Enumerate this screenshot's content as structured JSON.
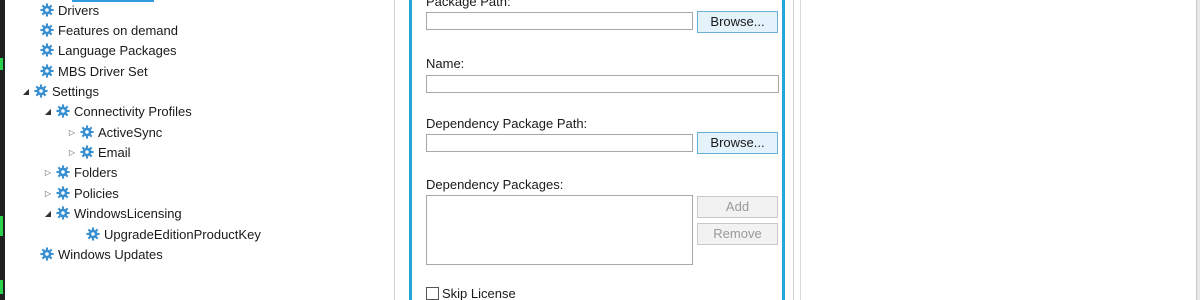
{
  "colors": {
    "gear": "#3a8fd0",
    "accent": "#25a7d8",
    "button_bg": "#e3f2fb"
  },
  "tree": {
    "items": [
      {
        "label": "Drivers",
        "icon": "gear-icon"
      },
      {
        "label": "Features on demand",
        "icon": "gear-icon"
      },
      {
        "label": "Language Packages",
        "icon": "gear-icon"
      },
      {
        "label": "MBS Driver Set",
        "icon": "gear-icon"
      },
      {
        "label": "Settings",
        "icon": "gear-icon",
        "expanded": true
      },
      {
        "label": "Connectivity Profiles",
        "icon": "gear-icon",
        "expanded": true
      },
      {
        "label": "ActiveSync",
        "icon": "gear-icon",
        "expanded": false
      },
      {
        "label": "Email",
        "icon": "gear-icon",
        "expanded": false
      },
      {
        "label": "Folders",
        "icon": "gear-icon",
        "expanded": false
      },
      {
        "label": "Policies",
        "icon": "gear-icon",
        "expanded": false
      },
      {
        "label": "WindowsLicensing",
        "icon": "gear-icon",
        "expanded": true
      },
      {
        "label": "UpgradeEditionProductKey",
        "icon": "gear-icon"
      },
      {
        "label": "Windows Updates",
        "icon": "gear-icon"
      }
    ]
  },
  "form": {
    "package_path_label": "Package Path:",
    "package_path_value": "",
    "browse_label_1": "Browse...",
    "name_label": "Name:",
    "name_value": "",
    "dependency_path_label": "Dependency Package Path:",
    "dependency_path_value": "",
    "browse_label_2": "Browse...",
    "dependency_packages_label": "Dependency Packages:",
    "add_label": "Add",
    "remove_label": "Remove",
    "skip_license_label": "Skip License"
  }
}
